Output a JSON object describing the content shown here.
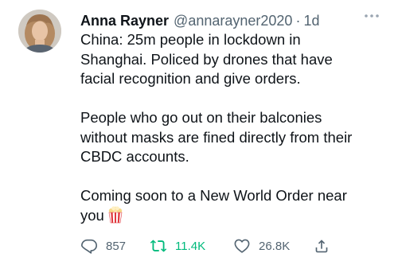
{
  "tweet": {
    "author_name": "Anna Rayner",
    "handle": "@annarayner2020",
    "separator": "·",
    "timestamp": "1d",
    "paragraphs": [
      [
        "China: 25m people in lockdown in",
        "Shanghai. Policed by drones that have",
        "facial recognition and give orders."
      ],
      [
        "People who go out on their balconies",
        "without masks are fined directly from their",
        "CBDC accounts."
      ],
      [
        "Coming soon to a New World Order near",
        "you"
      ]
    ],
    "emoji": "popcorn-icon"
  },
  "actions": {
    "replies": "857",
    "retweets": "11.4K",
    "likes": "26.8K"
  },
  "colors": {
    "text": "#0f1419",
    "secondary": "#536471",
    "retweet_active": "#00ba7c"
  },
  "icons": [
    "more-icon",
    "reply-icon",
    "retweet-icon",
    "like-icon",
    "share-icon",
    "popcorn-icon"
  ]
}
